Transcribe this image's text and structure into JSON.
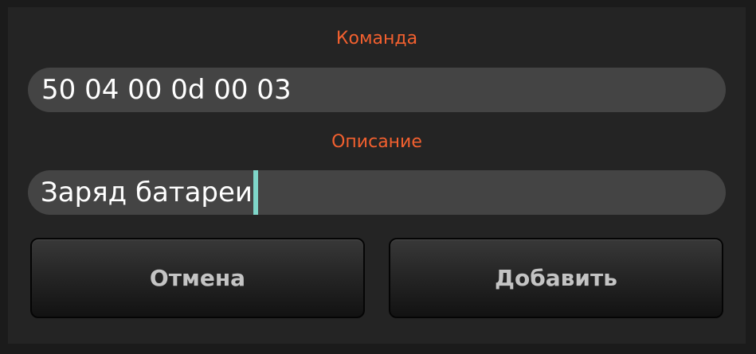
{
  "dialog": {
    "command_label": "Команда",
    "command_value": "50 04 00 0d 00 03",
    "description_label": "Описание",
    "description_value": "Заряд батареи",
    "cancel_label": "Отмена",
    "add_label": "Добавить"
  },
  "colors": {
    "accent": "#f2602f",
    "caret": "#7fd6c9",
    "field_bg": "#444444",
    "dialog_bg": "#242424"
  }
}
